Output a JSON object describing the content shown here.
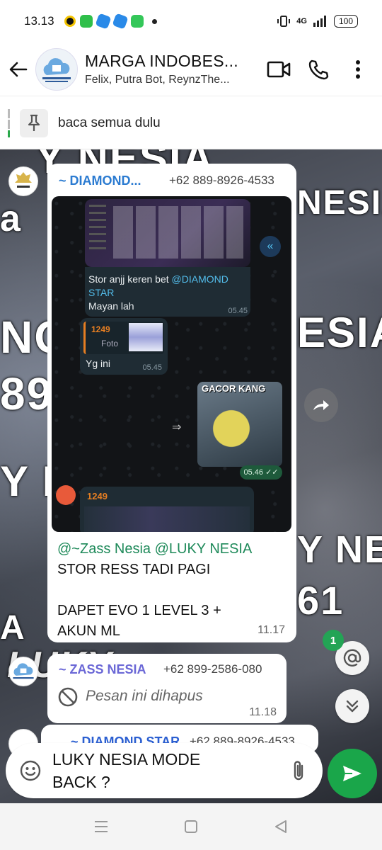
{
  "status": {
    "time": "13.13",
    "network": "4G",
    "battery": "100"
  },
  "header": {
    "title": "MARGA INDOBES...",
    "members": "Felix, Putra Bot, ReynzThe...",
    "avatar_text": "INDOBEST"
  },
  "pinned": {
    "text": "baca semua dulu"
  },
  "background_words": {
    "w1": "Y NESIA",
    "w2": "NESIA",
    "w3": "a",
    "w4": "NO",
    "w5": "ESIA",
    "w6": "89",
    "w7": "Y N",
    "w8": "Y NES",
    "w9": "61",
    "w10": "A",
    "w11": "LUKY"
  },
  "messages": [
    {
      "sender": "~ DIAMOND...",
      "phone": "+62 889-8926-4533",
      "time": "11.17",
      "caption_mention": "@~Zass Nesia @LUKY NESIA",
      "caption_line1": "STOR RESS TADI PAGI",
      "caption_line2": "DAPET EVO 1 LEVEL 3 +",
      "caption_line3": "AKUN ML",
      "screenshot": {
        "msg1_text": "Stor anjj keren bet",
        "msg1_mention": "@DIAMOND",
        "msg1_mention2": "STAR",
        "msg1_line2": "Mayan lah",
        "msg1_time": "05.45",
        "reply_name": "1249",
        "reply_type": "Foto",
        "msg2_text": "Yg ini",
        "msg2_time": "05.45",
        "sticker_text": "GACOR KANG",
        "sticker_time": "05.46",
        "msg3_name": "1249"
      }
    },
    {
      "sender": "~ ZASS NESIA",
      "phone": "+62 899-2586-080",
      "deleted_text": "Pesan ini dihapus",
      "time": "11.18"
    },
    {
      "sender": "~ DIAMOND STAR",
      "phone": "+62 889-8926-4533"
    }
  ],
  "unread_mentions": "1",
  "composer": {
    "text_line1": "LUKY NESIA MODE",
    "text_line2": "BACK ?"
  },
  "colors": {
    "accent_green": "#1aa64a",
    "sender_blue": "#2b7bd1",
    "mention_green": "#1f8a5a"
  }
}
